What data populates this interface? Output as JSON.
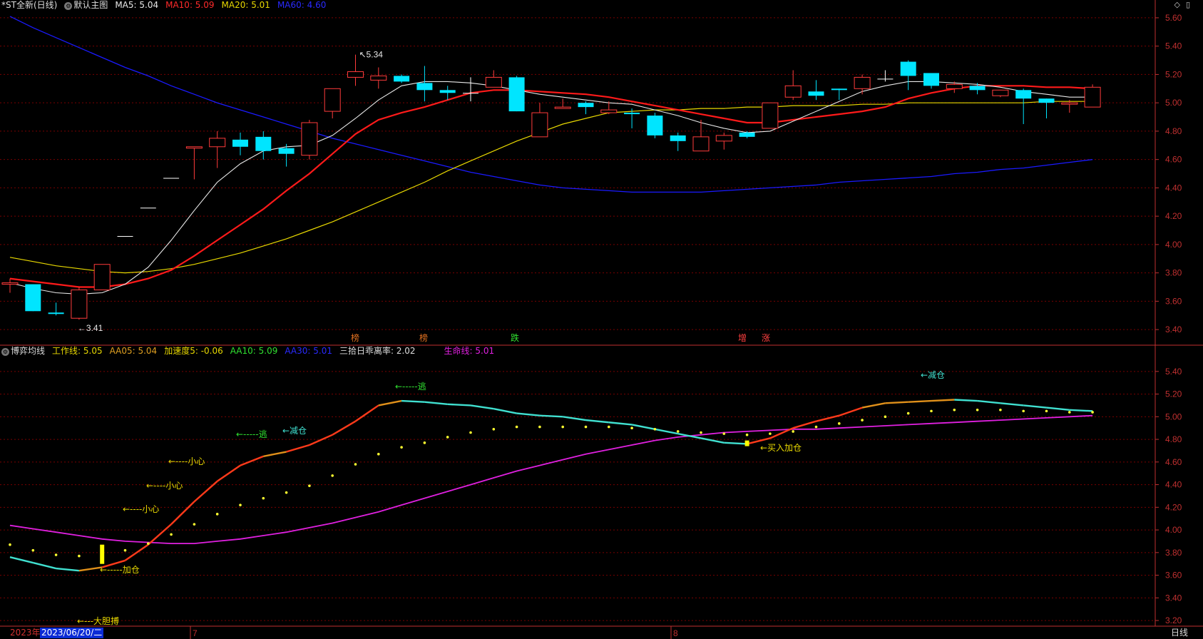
{
  "header_top": {
    "stock_name": "*ST全新(日线)",
    "chart_label": "默认主图",
    "ma5": "MA5: 5.04",
    "ma10": "MA10: 5.09",
    "ma20": "MA20: 5.01",
    "ma60": "MA60: 4.60"
  },
  "header_bottom": {
    "indicator_name": "博弈均线",
    "work_line": "工作线: 5.05",
    "aa05": "AA05: 5.04",
    "accel": "加速度5: -0.06",
    "aa10": "AA10: 5.09",
    "aa30": "AA30: 5.01",
    "deviation": "三拾日乖离率: 2.02",
    "life_line": "生命线: 5.01"
  },
  "colors": {
    "up": "#ff3b3b",
    "down": "#00e5ff",
    "ma5": "#e8e8e8",
    "ma10": "#ff1a1a",
    "ma20": "#e8d800",
    "ma60": "#1a1aff",
    "life": "#e020e0",
    "grid": "#7a0000",
    "axis": "#c03030"
  },
  "top_axis": [
    "5.60",
    "5.40",
    "5.20",
    "5.00",
    "4.80",
    "4.60",
    "4.40",
    "4.20",
    "4.00",
    "3.80",
    "3.60",
    "3.40"
  ],
  "bottom_axis": [
    "5.40",
    "5.20",
    "5.00",
    "4.80",
    "4.60",
    "4.40",
    "4.20",
    "4.00",
    "3.80",
    "3.60",
    "3.40",
    "3.20"
  ],
  "top_annotations": {
    "high": "5.34",
    "low": "←3.41",
    "tags": [
      "榜",
      "榜",
      "跌",
      "增",
      "涨"
    ]
  },
  "bottom_annotations": [
    "←---大胆搏",
    "←-----加仓",
    "←----小心",
    "←----小心",
    "←----小心",
    "←-----逃",
    "←减仓",
    "←-----逃",
    "←买入加仓",
    "←减仓"
  ],
  "date_axis": {
    "year": "2023年",
    "cursor_date": "2023/06/20/二",
    "month_7": "7",
    "month_8": "8",
    "period": "日线"
  },
  "icons": [
    "diamond-icon",
    "window-icon",
    "gear-icon"
  ],
  "chart_data": {
    "type": "candlestick",
    "price_ylim": [
      3.3,
      5.65
    ],
    "indicator_ylim": [
      3.15,
      5.55
    ],
    "candles": [
      {
        "o": 3.72,
        "c": 3.73,
        "h": 3.76,
        "l": 3.66
      },
      {
        "o": 3.72,
        "c": 3.53,
        "h": 3.72,
        "l": 3.53
      },
      {
        "o": 3.52,
        "c": 3.51,
        "h": 3.59,
        "l": 3.5
      },
      {
        "o": 3.48,
        "c": 3.68,
        "h": 3.7,
        "l": 3.47
      },
      {
        "o": 3.68,
        "c": 3.86,
        "h": 3.86,
        "l": 3.68
      },
      {
        "o": 4.06,
        "c": 4.06,
        "h": 4.06,
        "l": 4.06
      },
      {
        "o": 4.26,
        "c": 4.26,
        "h": 4.26,
        "l": 4.26
      },
      {
        "o": 4.47,
        "c": 4.47,
        "h": 4.47,
        "l": 4.47
      },
      {
        "o": 4.68,
        "c": 4.69,
        "h": 4.69,
        "l": 4.46
      },
      {
        "o": 4.69,
        "c": 4.75,
        "h": 4.8,
        "l": 4.54
      },
      {
        "o": 4.74,
        "c": 4.69,
        "h": 4.79,
        "l": 4.63
      },
      {
        "o": 4.76,
        "c": 4.66,
        "h": 4.8,
        "l": 4.6
      },
      {
        "o": 4.68,
        "c": 4.64,
        "h": 4.71,
        "l": 4.55
      },
      {
        "o": 4.63,
        "c": 4.86,
        "h": 4.88,
        "l": 4.6
      },
      {
        "o": 4.94,
        "c": 5.1,
        "h": 5.1,
        "l": 4.89
      },
      {
        "o": 5.18,
        "c": 5.22,
        "h": 5.34,
        "l": 5.12
      },
      {
        "o": 5.16,
        "c": 5.19,
        "h": 5.25,
        "l": 5.1
      },
      {
        "o": 5.19,
        "c": 5.15,
        "h": 5.2,
        "l": 5.14
      },
      {
        "o": 5.14,
        "c": 5.09,
        "h": 5.26,
        "l": 5.01
      },
      {
        "o": 5.09,
        "c": 5.07,
        "h": 5.12,
        "l": 5.02
      },
      {
        "o": 5.07,
        "c": 5.07,
        "h": 5.18,
        "l": 5.01
      },
      {
        "o": 5.11,
        "c": 5.18,
        "h": 5.23,
        "l": 5.11
      },
      {
        "o": 5.18,
        "c": 4.94,
        "h": 5.19,
        "l": 4.94
      },
      {
        "o": 4.76,
        "c": 4.93,
        "h": 5.0,
        "l": 4.76
      },
      {
        "o": 4.96,
        "c": 4.97,
        "h": 5.03,
        "l": 4.96
      },
      {
        "o": 5.0,
        "c": 4.97,
        "h": 5.01,
        "l": 4.92
      },
      {
        "o": 4.93,
        "c": 4.95,
        "h": 5.01,
        "l": 4.92
      },
      {
        "o": 4.93,
        "c": 4.92,
        "h": 4.96,
        "l": 4.82
      },
      {
        "o": 4.91,
        "c": 4.77,
        "h": 4.93,
        "l": 4.75
      },
      {
        "o": 4.77,
        "c": 4.73,
        "h": 4.79,
        "l": 4.66
      },
      {
        "o": 4.66,
        "c": 4.76,
        "h": 4.88,
        "l": 4.66
      },
      {
        "o": 4.73,
        "c": 4.77,
        "h": 4.79,
        "l": 4.67
      },
      {
        "o": 4.79,
        "c": 4.76,
        "h": 4.8,
        "l": 4.75
      },
      {
        "o": 4.82,
        "c": 5.0,
        "h": 5.0,
        "l": 4.82
      },
      {
        "o": 5.04,
        "c": 5.12,
        "h": 5.23,
        "l": 5.02
      },
      {
        "o": 5.08,
        "c": 5.05,
        "h": 5.16,
        "l": 5.02
      },
      {
        "o": 5.1,
        "c": 5.09,
        "h": 5.1,
        "l": 5.02
      },
      {
        "o": 5.1,
        "c": 5.18,
        "h": 5.2,
        "l": 5.06
      },
      {
        "o": 5.17,
        "c": 5.17,
        "h": 5.23,
        "l": 5.15
      },
      {
        "o": 5.29,
        "c": 5.19,
        "h": 5.3,
        "l": 5.09
      },
      {
        "o": 5.21,
        "c": 5.12,
        "h": 5.21,
        "l": 5.1
      },
      {
        "o": 5.1,
        "c": 5.13,
        "h": 5.15,
        "l": 5.07
      },
      {
        "o": 5.12,
        "c": 5.09,
        "h": 5.14,
        "l": 5.06
      },
      {
        "o": 5.05,
        "c": 5.09,
        "h": 5.09,
        "l": 5.04
      },
      {
        "o": 5.09,
        "c": 5.03,
        "h": 5.1,
        "l": 4.85
      },
      {
        "o": 5.03,
        "c": 5.0,
        "h": 5.03,
        "l": 4.89
      },
      {
        "o": 4.99,
        "c": 5.0,
        "h": 5.02,
        "l": 4.93
      },
      {
        "o": 4.97,
        "c": 5.11,
        "h": 5.13,
        "l": 4.97
      }
    ],
    "ma5": [
      3.73,
      3.69,
      3.66,
      3.65,
      3.66,
      3.72,
      3.84,
      4.03,
      4.24,
      4.44,
      4.57,
      4.66,
      4.69,
      4.7,
      4.77,
      4.89,
      5.02,
      5.12,
      5.15,
      5.15,
      5.14,
      5.12,
      5.09,
      5.06,
      5.04,
      5.02,
      5.0,
      4.99,
      4.95,
      4.91,
      4.86,
      4.82,
      4.79,
      4.8,
      4.87,
      4.94,
      5.01,
      5.08,
      5.12,
      5.15,
      5.15,
      5.14,
      5.13,
      5.11,
      5.08,
      5.06,
      5.04,
      5.04
    ],
    "ma10": [
      3.76,
      3.74,
      3.72,
      3.7,
      3.7,
      3.72,
      3.76,
      3.82,
      3.92,
      4.03,
      4.14,
      4.25,
      4.38,
      4.5,
      4.64,
      4.78,
      4.88,
      4.93,
      4.97,
      5.02,
      5.07,
      5.09,
      5.09,
      5.08,
      5.07,
      5.06,
      5.04,
      5.01,
      4.98,
      4.95,
      4.92,
      4.89,
      4.86,
      4.86,
      4.88,
      4.9,
      4.92,
      4.94,
      4.97,
      5.03,
      5.07,
      5.1,
      5.12,
      5.12,
      5.12,
      5.11,
      5.11,
      5.1
    ],
    "ma20": [
      3.91,
      3.88,
      3.85,
      3.83,
      3.81,
      3.8,
      3.81,
      3.83,
      3.86,
      3.9,
      3.94,
      3.99,
      4.04,
      4.1,
      4.16,
      4.23,
      4.3,
      4.37,
      4.44,
      4.52,
      4.59,
      4.66,
      4.73,
      4.79,
      4.85,
      4.89,
      4.93,
      4.94,
      4.95,
      4.95,
      4.96,
      4.96,
      4.97,
      4.97,
      4.98,
      4.98,
      4.98,
      4.99,
      4.99,
      5.0,
      5.0,
      5.0,
      5.0,
      5.0,
      5.0,
      5.01,
      5.01,
      5.01
    ],
    "ma60": [
      5.61,
      5.53,
      5.46,
      5.39,
      5.32,
      5.25,
      5.19,
      5.12,
      5.06,
      5.0,
      4.95,
      4.9,
      4.85,
      4.8,
      4.75,
      4.71,
      4.67,
      4.63,
      4.59,
      4.55,
      4.51,
      4.48,
      4.45,
      4.42,
      4.4,
      4.39,
      4.38,
      4.37,
      4.37,
      4.37,
      4.37,
      4.38,
      4.39,
      4.4,
      4.41,
      4.42,
      4.44,
      4.45,
      4.46,
      4.47,
      4.48,
      4.5,
      4.51,
      4.53,
      4.54,
      4.56,
      4.58,
      4.6
    ],
    "work_line": [
      3.76,
      3.71,
      3.66,
      3.64,
      3.67,
      3.73,
      3.87,
      4.05,
      4.25,
      4.43,
      4.57,
      4.65,
      4.69,
      4.75,
      4.84,
      4.96,
      5.1,
      5.14,
      5.13,
      5.11,
      5.1,
      5.07,
      5.03,
      5.01,
      5.0,
      4.97,
      4.95,
      4.93,
      4.89,
      4.85,
      4.81,
      4.77,
      4.76,
      4.81,
      4.9,
      4.96,
      5.01,
      5.08,
      5.12,
      5.13,
      5.14,
      5.15,
      5.14,
      5.12,
      5.1,
      5.08,
      5.06,
      5.05
    ],
    "dots": [
      3.87,
      3.82,
      3.78,
      3.77,
      3.79,
      3.82,
      3.88,
      3.96,
      4.05,
      4.14,
      4.22,
      4.28,
      4.33,
      4.39,
      4.48,
      4.58,
      4.67,
      4.73,
      4.77,
      4.82,
      4.86,
      4.89,
      4.91,
      4.91,
      4.91,
      4.91,
      4.91,
      4.9,
      4.89,
      4.87,
      4.86,
      4.85,
      4.84,
      4.85,
      4.87,
      4.91,
      4.94,
      4.97,
      5.0,
      5.03,
      5.05,
      5.06,
      5.06,
      5.06,
      5.05,
      5.05,
      5.04,
      5.04
    ],
    "life_line": [
      4.04,
      4.01,
      3.98,
      3.95,
      3.92,
      3.9,
      3.89,
      3.88,
      3.88,
      3.9,
      3.92,
      3.95,
      3.98,
      4.02,
      4.06,
      4.11,
      4.16,
      4.22,
      4.28,
      4.34,
      4.4,
      4.46,
      4.52,
      4.57,
      4.62,
      4.67,
      4.71,
      4.75,
      4.79,
      4.82,
      4.84,
      4.86,
      4.87,
      4.88,
      4.89,
      4.89,
      4.9,
      4.91,
      4.92,
      4.93,
      4.94,
      4.95,
      4.96,
      4.97,
      4.98,
      4.99,
      5.0,
      5.01
    ]
  }
}
